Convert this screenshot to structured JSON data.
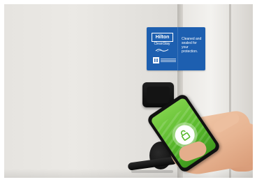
{
  "photo": {
    "description_type": "photo",
    "sign": {
      "brand": "Hilton",
      "program": "CleanStay",
      "message": "Cleaned and sealed for your protection.",
      "background_color": "#1d5fb0"
    },
    "phone": {
      "screen_color": "#58b82a",
      "icon": "lock-icon"
    },
    "colors": {
      "door": "#e6e4e0",
      "reader": "#141414",
      "handle": "#0a0a0a"
    }
  }
}
